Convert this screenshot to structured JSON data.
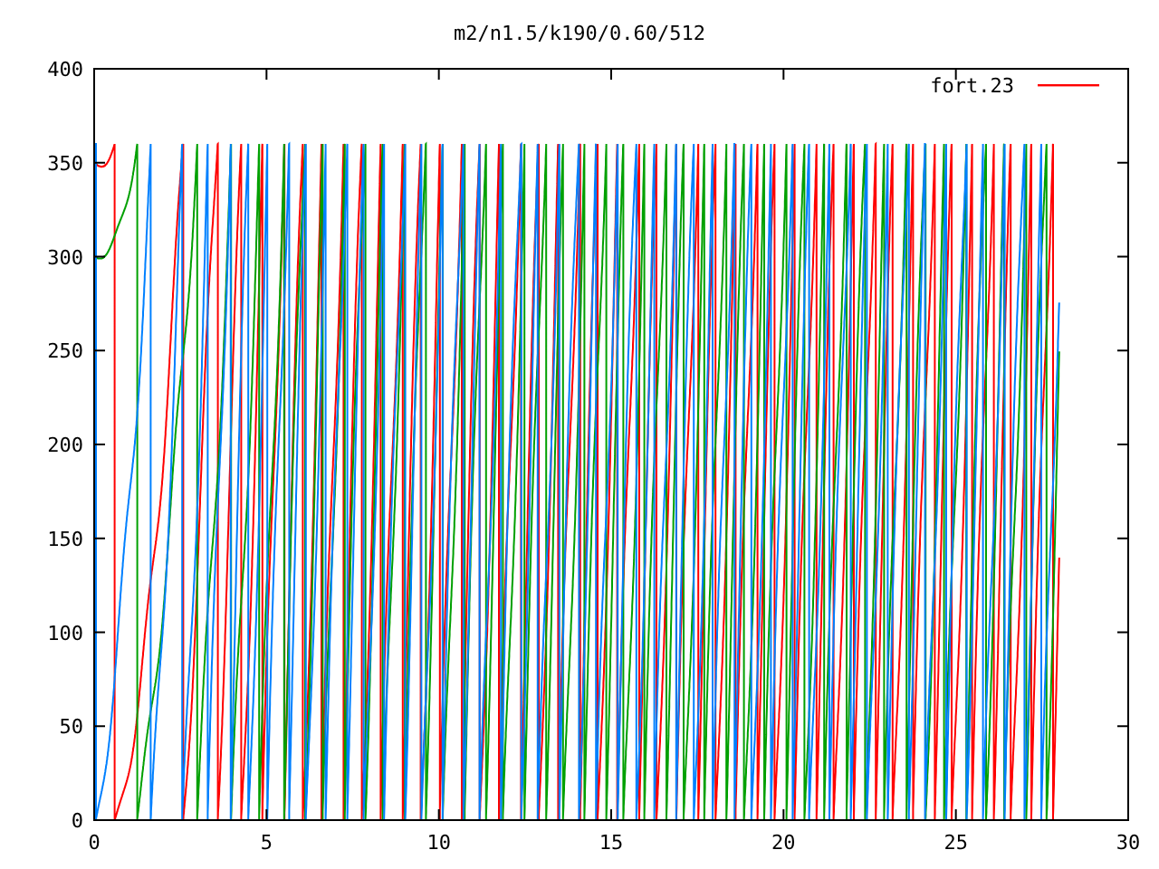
{
  "title": "m2/n1.5/k190/0.60/512",
  "legend": [
    {
      "label": "fort.23",
      "color": "#ff0000"
    }
  ],
  "x_axis": {
    "ticks": [
      "0",
      "5",
      "10",
      "15",
      "20",
      "25",
      "30"
    ]
  },
  "y_axis": {
    "ticks": [
      "400",
      "350",
      "300",
      "250",
      "200",
      "150",
      "100",
      "50",
      "0"
    ]
  }
}
